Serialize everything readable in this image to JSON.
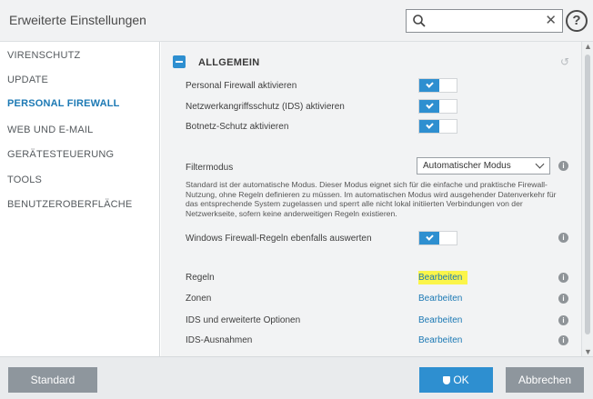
{
  "window": {
    "title": "Erweiterte Einstellungen"
  },
  "search": {
    "value": "",
    "placeholder": ""
  },
  "sidebar": {
    "items": [
      {
        "label": "VIRENSCHUTZ"
      },
      {
        "label": "UPDATE"
      },
      {
        "label": "PERSONAL FIREWALL",
        "active": true
      },
      {
        "label": "WEB UND E-MAIL"
      },
      {
        "label": "GERÄTESTEUERUNG"
      },
      {
        "label": "TOOLS"
      },
      {
        "label": "BENUTZEROBERFLÄCHE"
      }
    ]
  },
  "section": {
    "title": "ALLGEMEIN"
  },
  "settings": {
    "personal_firewall": {
      "label": "Personal Firewall aktivieren",
      "enabled": true
    },
    "ids": {
      "label": "Netzwerkangriffsschutz (IDS) aktivieren",
      "enabled": true
    },
    "botnet": {
      "label": "Botnetz-Schutz aktivieren",
      "enabled": true
    },
    "filtermode": {
      "label": "Filtermodus",
      "selected": "Automatischer Modus",
      "description": "Standard ist der automatische Modus. Dieser Modus eignet sich für die einfache und praktische Firewall-Nutzung, ohne Regeln definieren zu müssen. Im automatischen Modus wird ausgehender Datenverkehr für das entsprechende System zugelassen und sperrt alle nicht lokal initiierten Verbindungen von der Netzwerkseite, sofern keine anderweitigen Regeln existieren."
    },
    "windows_rules": {
      "label": "Windows Firewall-Regeln ebenfalls auswerten",
      "enabled": true
    },
    "regeln": {
      "label": "Regeln",
      "link": "Bearbeiten"
    },
    "zonen": {
      "label": "Zonen",
      "link": "Bearbeiten"
    },
    "ids_options": {
      "label": "IDS und erweiterte Optionen",
      "link": "Bearbeiten"
    },
    "ids_exceptions": {
      "label": "IDS-Ausnahmen",
      "link": "Bearbeiten"
    }
  },
  "footer": {
    "standard_label": "Standard",
    "ok_label": "OK",
    "cancel_label": "Abbrechen"
  },
  "colors": {
    "accent": "#2e8fd0",
    "highlight": "#fbf54a",
    "button_gray": "#8e969d"
  }
}
